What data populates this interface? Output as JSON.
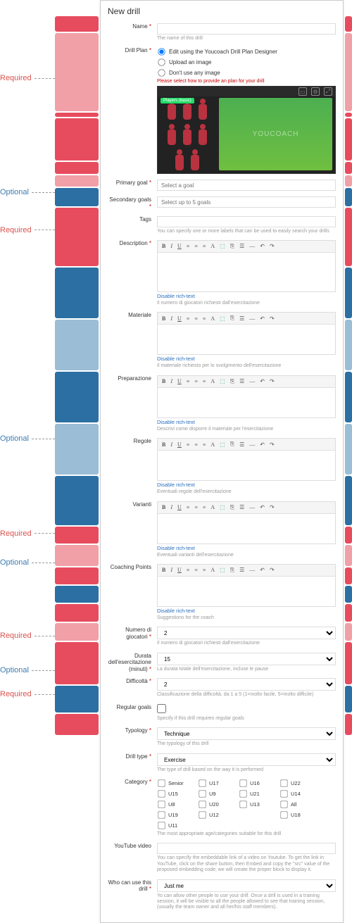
{
  "annotations": {
    "required": "Required",
    "optional": "Optional"
  },
  "title": "New drill",
  "name": {
    "label": "Name",
    "help": "The name of this drill"
  },
  "plan": {
    "label": "Drill Plan",
    "opt_edit": "Edit using the Youcoach Drill Plan Designer",
    "opt_upload": "Upload an image",
    "opt_none": "Don't use any image",
    "warn": "Please select how to provide an plan for your drill",
    "badge": "Players (basic)",
    "wm": "YOUCOACH"
  },
  "primary_goal": {
    "label": "Primary goal",
    "placeholder": "Select a goal"
  },
  "secondary_goals": {
    "label": "Secondary goals",
    "placeholder": "Select up to 5 goals"
  },
  "tags": {
    "label": "Tags",
    "help": "You can specify one or more labels that can be used to easily search your drills"
  },
  "description": {
    "label": "Description",
    "disable": "Disable rich-text",
    "help": "Il numero di giocatori richiesti dall'esercitazione"
  },
  "materiale": {
    "label": "Materiale",
    "disable": "Disable rich-text",
    "help": "Il materiale richiesto per lo svolgimento dell'esercitazione"
  },
  "preparazione": {
    "label": "Preparazione",
    "disable": "Disable rich-text",
    "help": "Descrivi come disporre il materiale per l'esercitazione"
  },
  "regole": {
    "label": "Regole",
    "disable": "Disable rich-text",
    "help": "Eventuali regole dell'esercitazione"
  },
  "varianti": {
    "label": "Varianti",
    "disable": "Disable rich-text",
    "help": "Eventuali varianti dell'esercitazione"
  },
  "coaching": {
    "label": "Coaching Points",
    "disable": "Disable rich-text",
    "help": "Suggestions for the coach"
  },
  "players_count": {
    "label": "Numero di giocatori",
    "value": "2",
    "help": "Il numero di giocatori richiesti dall'esercitazione"
  },
  "duration": {
    "label": "Durata dell'esercitazione (minuti)",
    "value": "15",
    "help": "La durata totale dell'esercitazione, incluse le pause"
  },
  "difficulty": {
    "label": "Difficoltà",
    "value": "2",
    "help": "Classificazione della difficoltà, da 1 a 5 (1=molto facile, 5=molto difficile)"
  },
  "regular_goals": {
    "label": "Regular goals",
    "help": "Specify if this drill requires regular goals"
  },
  "typology": {
    "label": "Typology",
    "value": "Technique",
    "help": "The typology of this drill"
  },
  "drill_type": {
    "label": "Drill type",
    "value": "Exercise",
    "help": "The type of drill based on the way it is performed"
  },
  "category": {
    "label": "Category",
    "items": [
      "Senior",
      "U17",
      "U16",
      "U22",
      "U15",
      "U9",
      "U21",
      "U14",
      "U8",
      "U20",
      "U13",
      "All",
      "U19",
      "U12",
      "",
      "U18",
      "U11",
      ""
    ],
    "help": "The most appropriate age/categories suitable for this drill"
  },
  "youtube": {
    "label": "YouTube video",
    "help": "You can specify the embeddable link of a video on Youtube. To get the link in YouTube, click on the share button, then Embed and copy the \"src\" value of the proposed embedding code; we will create the proper block to display it."
  },
  "who": {
    "label": "Who can use this drill",
    "value": "Just me",
    "help": "Yo can allow other people to use your drill. Once a drill is used in a training session, it will be visible to all the people allowed to see that training session, (usually the team owner and all her/his staff members)."
  }
}
